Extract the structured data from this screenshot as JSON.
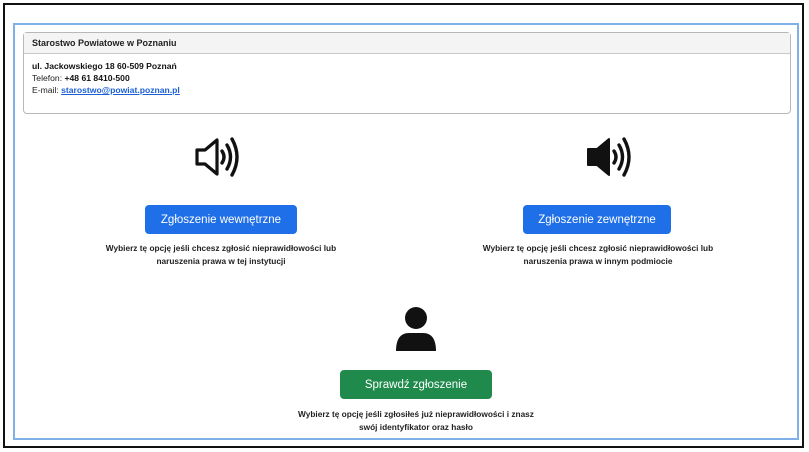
{
  "institution": {
    "name": "Starostwo Powiatowe w Poznaniu",
    "address": "ul. Jackowskiego 18 60-509 Poznań",
    "phone_label": "Telefon: ",
    "phone": "+48 61 8410-500",
    "email_label": "E-mail: ",
    "email": "starostwo@powiat.poznan.pl"
  },
  "options": {
    "internal": {
      "icon": "speaker-outline-icon",
      "button_label": "Zgłoszenie wewnętrzne",
      "description_line1": "Wybierz tę opcję jeśli chcesz zgłosić nieprawidłowości lub",
      "description_line2": "naruszenia prawa w tej instytucji"
    },
    "external": {
      "icon": "speaker-filled-icon",
      "button_label": "Zgłoszenie zewnętrzne",
      "description_line1": "Wybierz tę opcję jeśli chcesz zgłosić nieprawidłowości lub",
      "description_line2": "naruszenia prawa w innym podmiocie"
    },
    "check": {
      "icon": "user-icon",
      "button_label": "Sprawdź zgłoszenie",
      "description_line1": "Wybierz tę opcję jeśli zgłosiłeś już nieprawidłowości i znasz",
      "description_line2": "swój identyfikator oraz hasło"
    }
  },
  "colors": {
    "primary_button": "#1f6fe8",
    "success_button": "#1f8a4c",
    "link": "#1b5fd6",
    "frame_border": "#7fb0e8"
  }
}
